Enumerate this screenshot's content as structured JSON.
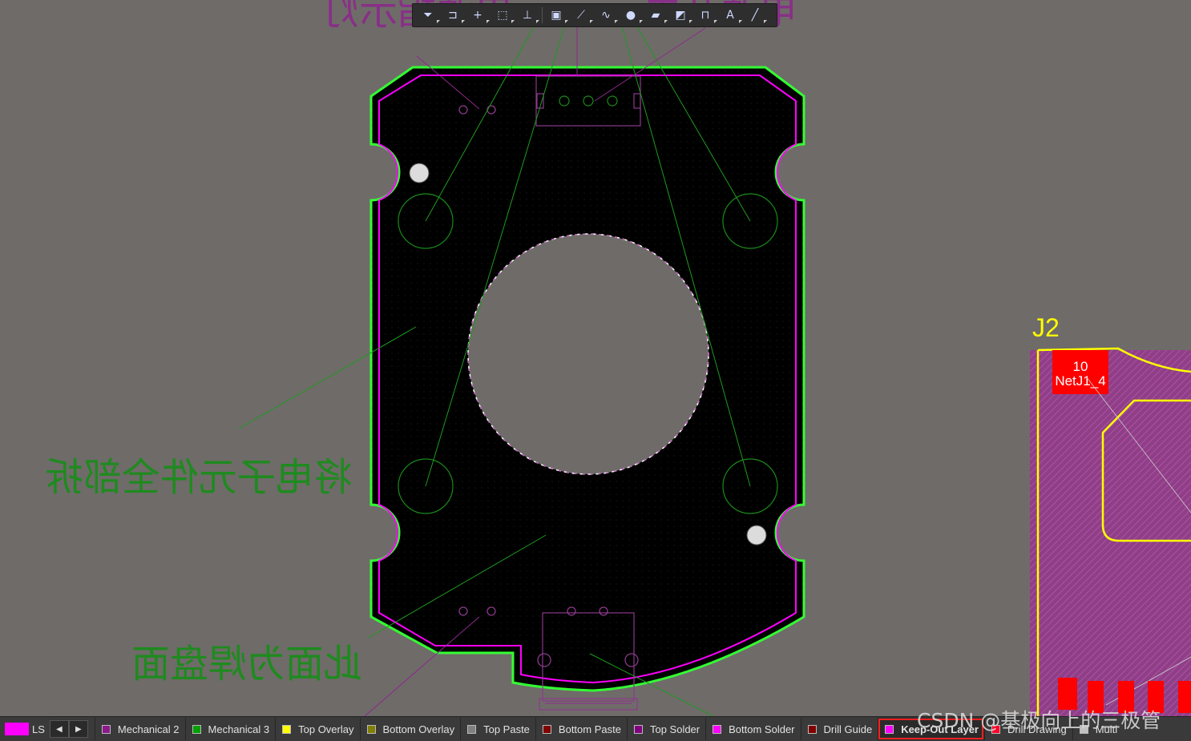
{
  "toolbar": {
    "tools": [
      {
        "icon": "filter-icon",
        "glyph": "⏷"
      },
      {
        "icon": "route-icon",
        "glyph": "⊐"
      },
      {
        "icon": "crosshair-icon",
        "glyph": "+"
      },
      {
        "icon": "select-rect-icon",
        "glyph": "⬚"
      },
      {
        "icon": "align-icon",
        "glyph": "⊥"
      },
      {
        "icon": "component-icon",
        "glyph": "▣"
      },
      {
        "icon": "interactive-route-icon",
        "glyph": "⟋"
      },
      {
        "icon": "diff-pair-icon",
        "glyph": "∿"
      },
      {
        "icon": "via-icon",
        "glyph": "●"
      },
      {
        "icon": "polygon-icon",
        "glyph": "▰"
      },
      {
        "icon": "region-icon",
        "glyph": "◩"
      },
      {
        "icon": "dimension-icon",
        "glyph": "⊓"
      },
      {
        "icon": "text-icon",
        "glyph": "A"
      },
      {
        "icon": "line-icon",
        "glyph": "╱"
      }
    ]
  },
  "canvas": {
    "text_top": "电源指示灯",
    "text_top_right": "电源开关",
    "text_middle": "将电子元件全部拆",
    "text_bottom": "此面为焊盘面",
    "designator": "J2",
    "pad_number": "10",
    "pad_net": "NetJ1_4"
  },
  "colors": {
    "board": "#000000",
    "keepout": "#ff00ff",
    "outline": "#33ff33",
    "overlay": "#ffff00",
    "pad": "#ff0000",
    "background": "#6f6b69"
  },
  "layerbar": {
    "current_label": "LS",
    "layers": [
      {
        "name": "Mechanical 2",
        "color": "#8b1a8b"
      },
      {
        "name": "Mechanical 3",
        "color": "#00a000"
      },
      {
        "name": "Top Overlay",
        "color": "#ffff00"
      },
      {
        "name": "Bottom Overlay",
        "color": "#808000"
      },
      {
        "name": "Top Paste",
        "color": "#808080"
      },
      {
        "name": "Bottom Paste",
        "color": "#800000"
      },
      {
        "name": "Top Solder",
        "color": "#800080"
      },
      {
        "name": "Bottom Solder",
        "color": "#ff00ff"
      },
      {
        "name": "Drill Guide",
        "color": "#800000"
      },
      {
        "name": "Keep-Out Layer",
        "color": "#ff00ff",
        "active": true
      },
      {
        "name": "Drill Drawing",
        "color": "#ff002a"
      },
      {
        "name": "Multi",
        "color": "#c0c0c0"
      }
    ]
  },
  "watermark": "CSDN @基极向上的三极管"
}
